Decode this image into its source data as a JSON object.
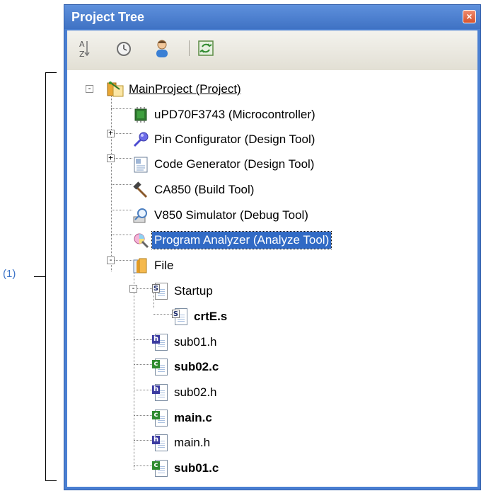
{
  "callout": {
    "label": "(1)"
  },
  "panel": {
    "title": "Project Tree",
    "close_icon": "close-icon",
    "toolbar": [
      {
        "name": "sort-az-button",
        "icon": "sort-az-icon"
      },
      {
        "name": "history-button",
        "icon": "clock-icon"
      },
      {
        "name": "user-button",
        "icon": "person-icon"
      },
      {
        "name": "refresh-button",
        "icon": "refresh-icon"
      }
    ]
  },
  "tree": {
    "nodes": [
      {
        "label": "MainProject (Project)",
        "icon": "project-icon",
        "style": "link"
      },
      {
        "label": "uPD70F3743 (Microcontroller)",
        "icon": "chip-icon"
      },
      {
        "label": "Pin Configurator (Design Tool)",
        "icon": "pin-icon"
      },
      {
        "label": "Code Generator (Design Tool)",
        "icon": "code-generator-icon"
      },
      {
        "label": "CA850 (Build Tool)",
        "icon": "hammer-icon"
      },
      {
        "label": "V850 Simulator (Debug Tool)",
        "icon": "simulator-icon"
      },
      {
        "label": "Program Analyzer (Analyze Tool)",
        "icon": "analyzer-icon",
        "style": "selected"
      },
      {
        "label": "File",
        "icon": "folder-icon"
      },
      {
        "label": "Startup",
        "icon": "asm-folder-icon"
      },
      {
        "label": "crtE.s",
        "icon": "asm-file-icon",
        "style": "bold"
      },
      {
        "label": "sub01.h",
        "icon": "header-file-icon"
      },
      {
        "label": "sub02.c",
        "icon": "c-file-icon",
        "style": "bold"
      },
      {
        "label": "sub02.h",
        "icon": "header-file-icon"
      },
      {
        "label": "main.c",
        "icon": "c-file-icon",
        "style": "bold"
      },
      {
        "label": "main.h",
        "icon": "header-file-icon"
      },
      {
        "label": "sub01.c",
        "icon": "c-file-icon",
        "style": "bold"
      }
    ],
    "expanders": [
      "-",
      "+",
      "+",
      "-",
      "-"
    ]
  },
  "colors": {
    "accent": "#4a7fd2",
    "selection": "#316ac5",
    "callout": "#3b73c8"
  }
}
